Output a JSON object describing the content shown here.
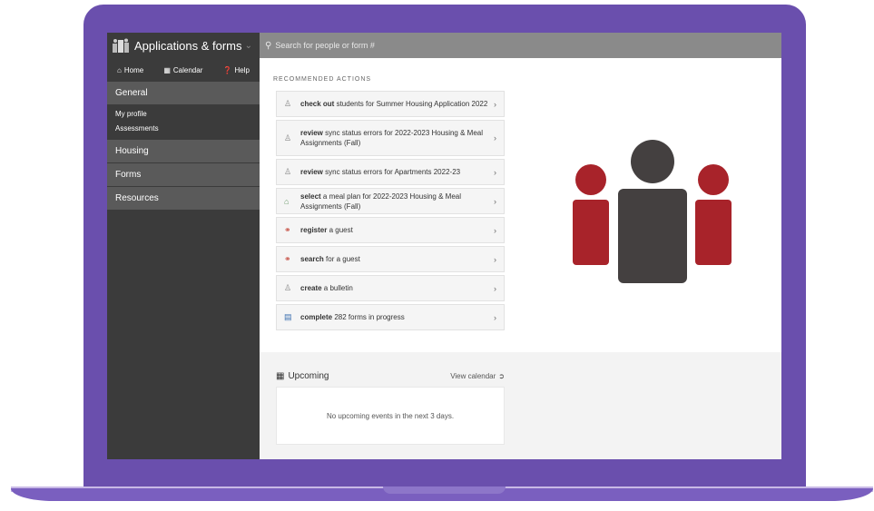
{
  "app": {
    "title": "Applications & forms"
  },
  "nav": {
    "home": "Home",
    "calendar": "Calendar",
    "help": "Help"
  },
  "sidebar": {
    "general": "General",
    "general_items": [
      "My profile",
      "Assessments"
    ],
    "housing": "Housing",
    "forms": "Forms",
    "resources": "Resources"
  },
  "search": {
    "placeholder": "Search for people or form #"
  },
  "recommended": {
    "label": "RECOMMENDED ACTIONS",
    "actions": [
      {
        "verb": "check out",
        "rest": " students for Summer Housing Application 2022",
        "icon": "user-icon"
      },
      {
        "verb": "review",
        "rest": " sync status errors for 2022-2023 Housing & Meal Assignments (Fall)",
        "icon": "user-icon"
      },
      {
        "verb": "review",
        "rest": " sync status errors for Apartments 2022-23",
        "icon": "user-icon"
      },
      {
        "verb": "select",
        "rest": " a meal plan for 2022-2023 Housing & Meal Assignments (Fall)",
        "icon": "home-icon"
      },
      {
        "verb": "register",
        "rest": " a guest",
        "icon": "guest-icon"
      },
      {
        "verb": "search",
        "rest": " for a guest",
        "icon": "guest-icon"
      },
      {
        "verb": "create",
        "rest": " a bulletin",
        "icon": "user-icon"
      },
      {
        "verb": "complete",
        "rest": " 282 forms in progress",
        "icon": "document-icon"
      }
    ]
  },
  "upcoming": {
    "title": "Upcoming",
    "link": "View calendar",
    "empty": "No upcoming events in the next 3 days."
  },
  "colors": {
    "frame": "#6a4fad",
    "sidebar": "#3b3b3b",
    "accent_red": "#a8232a",
    "dark_figure": "#444040"
  }
}
